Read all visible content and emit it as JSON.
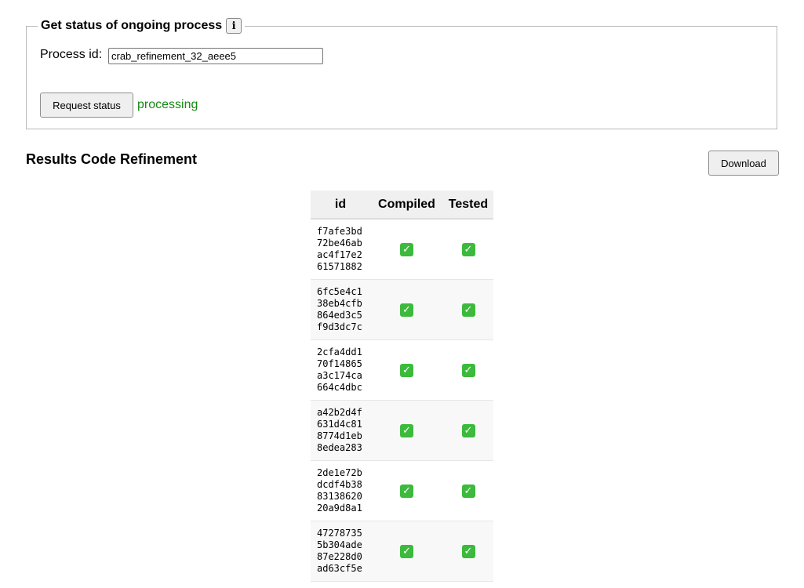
{
  "status_panel": {
    "title": "Get status of ongoing process",
    "info_icon": "i",
    "process_id_label": "Process id:",
    "process_id_value": "crab_refinement_32_aeee5",
    "request_button": "Request status",
    "status_text": "processing",
    "status_color": "#138a13"
  },
  "results": {
    "title": "Results Code Refinement",
    "download_button": "Download",
    "columns": [
      "id",
      "Compiled",
      "Tested"
    ],
    "rows": [
      {
        "id": [
          "f7afe3bd",
          "72be46ab",
          "ac4f17e2",
          "61571882"
        ],
        "compiled": true,
        "tested": true
      },
      {
        "id": [
          "6fc5e4c1",
          "38eb4cfb",
          "864ed3c5",
          "f9d3dc7c"
        ],
        "compiled": true,
        "tested": true
      },
      {
        "id": [
          "2cfa4dd1",
          "70f14865",
          "a3c174ca",
          "664c4dbc"
        ],
        "compiled": true,
        "tested": true
      },
      {
        "id": [
          "a42b2d4f",
          "631d4c81",
          "8774d1eb",
          "8edea283"
        ],
        "compiled": true,
        "tested": true
      },
      {
        "id": [
          "2de1e72b",
          "dcdf4b38",
          "83138620",
          "20a9d8a1"
        ],
        "compiled": true,
        "tested": true
      },
      {
        "id": [
          "47278735",
          "5b304ade",
          "87e228d0",
          "ad63cf5e"
        ],
        "compiled": true,
        "tested": true
      }
    ],
    "check_icon": "check-mark-icon",
    "check_color": "#3cba3c"
  }
}
